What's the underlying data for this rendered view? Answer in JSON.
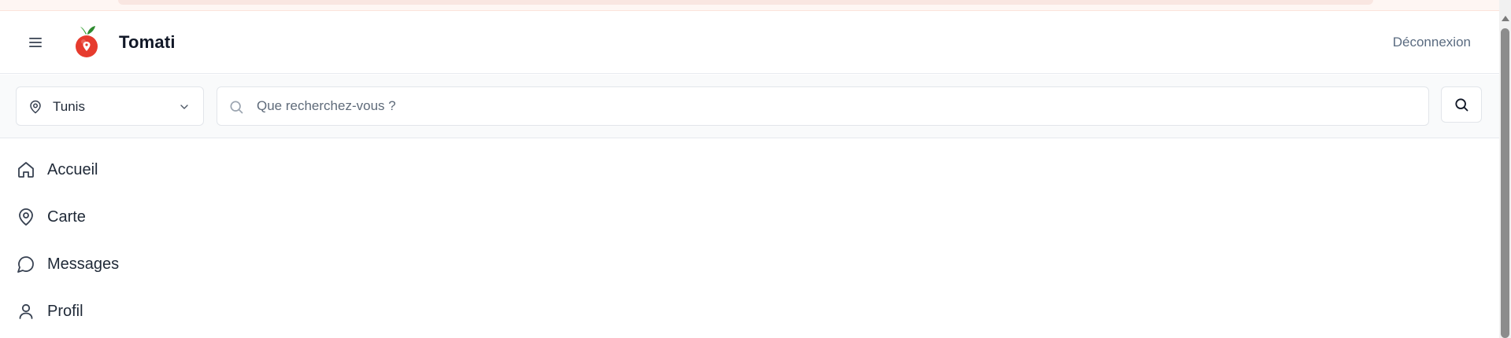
{
  "header": {
    "brand": "Tomati",
    "logout_label": "Déconnexion",
    "menu_icon": "hamburger-menu-icon",
    "logo_icon": "tomato-pin-logo"
  },
  "search_bar": {
    "location_value": "Tunis",
    "search_placeholder": "Que recherchez-vous ?",
    "search_value": ""
  },
  "nav": {
    "items": [
      {
        "label": "Accueil",
        "icon": "home-icon"
      },
      {
        "label": "Carte",
        "icon": "map-pin-icon"
      },
      {
        "label": "Messages",
        "icon": "message-bubble-icon"
      },
      {
        "label": "Profil",
        "icon": "user-icon"
      }
    ]
  },
  "colors": {
    "logo_red": "#e63b2e",
    "leaf_green": "#3ca33a",
    "muted_text": "#5a6b80",
    "border": "#e2e5ea",
    "banner": "#fef6f3"
  }
}
